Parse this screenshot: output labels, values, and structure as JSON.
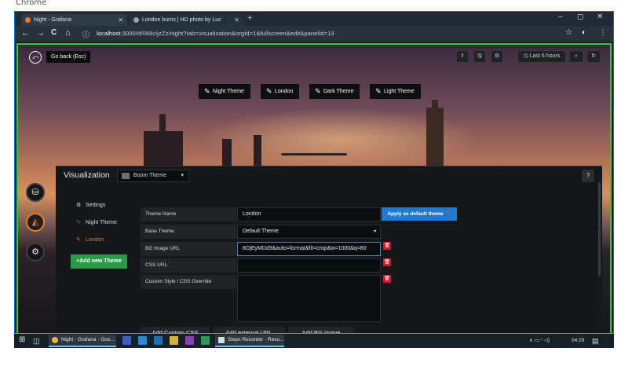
{
  "caption": "Chrome",
  "browser": {
    "tabs": [
      {
        "title": "Night - Grafana",
        "close": "✕",
        "color": "#f2752a"
      },
      {
        "title": "London burns | HD photo by Luc",
        "close": "✕",
        "color": "#9aa3ab"
      }
    ],
    "new_tab": "+",
    "window_controls": {
      "minimize": "–",
      "maximize": "◻",
      "close": "✕"
    },
    "nav": {
      "back": "←",
      "forward": "→",
      "reload": "C",
      "home": "⌂",
      "info": "ⓘ"
    },
    "url_host": "localhost",
    "url_rest": ":3000/d/068cIjzZz/night?tab=visualization&orgId=1&fullscreen&edit&panelId=13",
    "star": "☆",
    "profile": "◐",
    "menu": "⋮"
  },
  "grafana": {
    "go_back_icon": "⤺",
    "go_back_label": "Go back (Esc)",
    "toolbar": {
      "share": "⇪",
      "save": "🖫",
      "settings": "⚙",
      "time_range": "◷ Last 6 hours",
      "zoom_out": "⌕",
      "refresh": "↻"
    },
    "theme_buttons": [
      {
        "label": "Night Theme",
        "icon": "✎"
      },
      {
        "label": "London",
        "icon": "✎"
      },
      {
        "label": "Dark Theme",
        "icon": "✎"
      },
      {
        "label": "Light Theme",
        "icon": "✎"
      }
    ],
    "side_icons": {
      "queries": "⛁",
      "visualization": "◭",
      "general": "⚙"
    },
    "panel": {
      "title": "Visualization",
      "plugin": "Boom Theme",
      "plugin_caret": "▾",
      "help": "?",
      "nav": [
        {
          "icon": "⚙",
          "label": "Settings"
        },
        {
          "icon": "✎",
          "label": "Night Theme"
        },
        {
          "icon": "✎",
          "label": "London"
        }
      ],
      "add_new_theme": "+Add new Theme",
      "fields": {
        "theme_name_label": "Theme Name",
        "theme_name_value": "London",
        "base_theme_label": "Base Theme",
        "base_theme_value": "Default Theme",
        "bg_image_label": "BG Image URL",
        "bg_image_value": "8OjEyMDd9&auto=format&fit=crop&w=1000&q=80",
        "css_url_label": "CSS URL",
        "css_url_value": "",
        "custom_style_label": "Custom Style / CSS Override"
      },
      "apply_default": "Apply as default theme ❓",
      "delete_icon": "🗑",
      "bottom_buttons": [
        "Add Custom CSS",
        "Add external URL",
        "Add BG image"
      ]
    }
  },
  "taskbar": {
    "start": "⊞",
    "task_view": "◫",
    "grafana_window": "Night · Grafana · Goo...",
    "steps_recorder": "Steps Recorder · Reco...",
    "tray": "∧ ▭ ◜ ◁)",
    "time": "04:29",
    "notifications": "▤"
  }
}
